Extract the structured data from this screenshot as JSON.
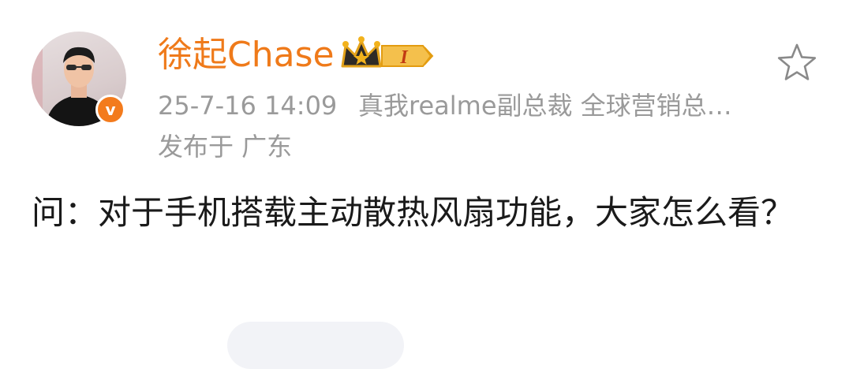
{
  "post": {
    "author": {
      "name": "徐起Chase",
      "vip_level_label": "I"
    },
    "meta": {
      "time": "25-7-16 14:09",
      "title": "真我realme副总裁 全球营销总…",
      "location": "发布于 广东"
    },
    "text": "问：对于手机搭载主动散热风扇功能，大家怎么看？"
  },
  "colors": {
    "name": "#ef7a1a",
    "meta": "#9a9a9a",
    "text": "#1a1a1a",
    "verified_badge": "#f37b1d"
  },
  "icons": {
    "verified": "v-verified-icon",
    "vip": "crown-vip-icon",
    "favorite": "star-outline-icon"
  }
}
